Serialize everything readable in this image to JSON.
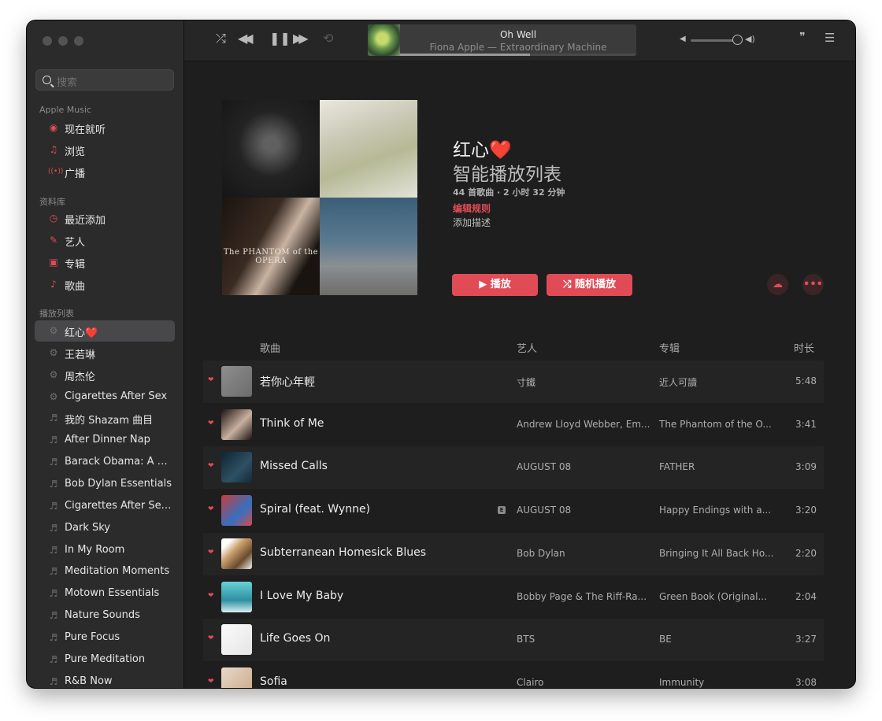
{
  "colors": {
    "accent": "#e14b56",
    "window_bg": "#1e1e1e",
    "sidebar_bg": "#2b2b2c"
  },
  "sidebar": {
    "search_placeholder": "搜索",
    "section_apple_music": "Apple Music",
    "apple_music_items": [
      {
        "label": "现在就听",
        "icon": "play-circle-icon"
      },
      {
        "label": "浏览",
        "icon": "music-note-icon"
      },
      {
        "label": "广播",
        "icon": "radio-icon"
      }
    ],
    "section_library": "资料库",
    "library_items": [
      {
        "label": "最近添加",
        "icon": "clock-icon"
      },
      {
        "label": "艺人",
        "icon": "microphone-icon"
      },
      {
        "label": "专辑",
        "icon": "album-icon"
      },
      {
        "label": "歌曲",
        "icon": "note-icon"
      }
    ],
    "section_playlists": "播放列表",
    "playlists": [
      {
        "label": "红心❤️",
        "icon": "smart-playlist-icon",
        "selected": true
      },
      {
        "label": "王若琳",
        "icon": "smart-playlist-icon"
      },
      {
        "label": "周杰伦",
        "icon": "smart-playlist-icon"
      },
      {
        "label": "Cigarettes After Sex",
        "icon": "smart-playlist-icon"
      },
      {
        "label": "我的 Shazam 曲目",
        "icon": "playlist-icon"
      },
      {
        "label": "After Dinner Nap",
        "icon": "playlist-icon"
      },
      {
        "label": "Barack Obama: A Pr...",
        "icon": "playlist-icon"
      },
      {
        "label": "Bob Dylan Essentials",
        "icon": "playlist-icon"
      },
      {
        "label": "Cigarettes After Sex...",
        "icon": "playlist-icon"
      },
      {
        "label": "Dark Sky",
        "icon": "playlist-icon"
      },
      {
        "label": "In My Room",
        "icon": "playlist-icon"
      },
      {
        "label": "Meditation Moments",
        "icon": "playlist-icon"
      },
      {
        "label": "Motown Essentials",
        "icon": "playlist-icon"
      },
      {
        "label": "Nature Sounds",
        "icon": "playlist-icon"
      },
      {
        "label": "Pure Focus",
        "icon": "playlist-icon"
      },
      {
        "label": "Pure Meditation",
        "icon": "playlist-icon"
      },
      {
        "label": "R&B Now",
        "icon": "playlist-icon"
      }
    ]
  },
  "toolbar": {
    "now_playing_title": "Oh Well",
    "now_playing_subtitle": "Fiona Apple — Extraordinary Machine",
    "progress": 0.55,
    "volume": 0.98
  },
  "playlist": {
    "title": "红心❤️",
    "subtitle": "智能播放列表",
    "meta": "44 首歌曲 · 2 小时 32 分钟",
    "edit_rules": "编辑规则",
    "add_description": "添加描述",
    "play_label": "▶ 播放",
    "shuffle_label": "随机播放",
    "cover_text": "The PHANTOM of the OPERA"
  },
  "table": {
    "headers": {
      "song": "歌曲",
      "artist": "艺人",
      "album": "专辑",
      "duration": "时长"
    },
    "rows": [
      {
        "song": "若你心年輕",
        "artist": "寸鐵",
        "album": "近人可讀",
        "duration": "5:48",
        "explicit": false
      },
      {
        "song": "Think of Me",
        "artist": "Andrew Lloyd Webber, Em...",
        "album": "The Phantom of the O...",
        "duration": "3:41",
        "explicit": false
      },
      {
        "song": "Missed Calls",
        "artist": "AUGUST 08",
        "album": "FATHER",
        "duration": "3:09",
        "explicit": false
      },
      {
        "song": "Spiral (feat. Wynne)",
        "artist": "AUGUST 08",
        "album": "Happy Endings with a...",
        "duration": "3:20",
        "explicit": true
      },
      {
        "song": "Subterranean Homesick Blues",
        "artist": "Bob Dylan",
        "album": "Bringing It All Back Ho...",
        "duration": "2:20",
        "explicit": false
      },
      {
        "song": "I Love My Baby",
        "artist": "Bobby Page & The Riff-Ra...",
        "album": "Green Book (Original...",
        "duration": "2:04",
        "explicit": false
      },
      {
        "song": "Life Goes On",
        "artist": "BTS",
        "album": "BE",
        "duration": "3:27",
        "explicit": false
      },
      {
        "song": "Sofia",
        "artist": "Clairo",
        "album": "Immunity",
        "duration": "3:08",
        "explicit": false
      }
    ]
  }
}
